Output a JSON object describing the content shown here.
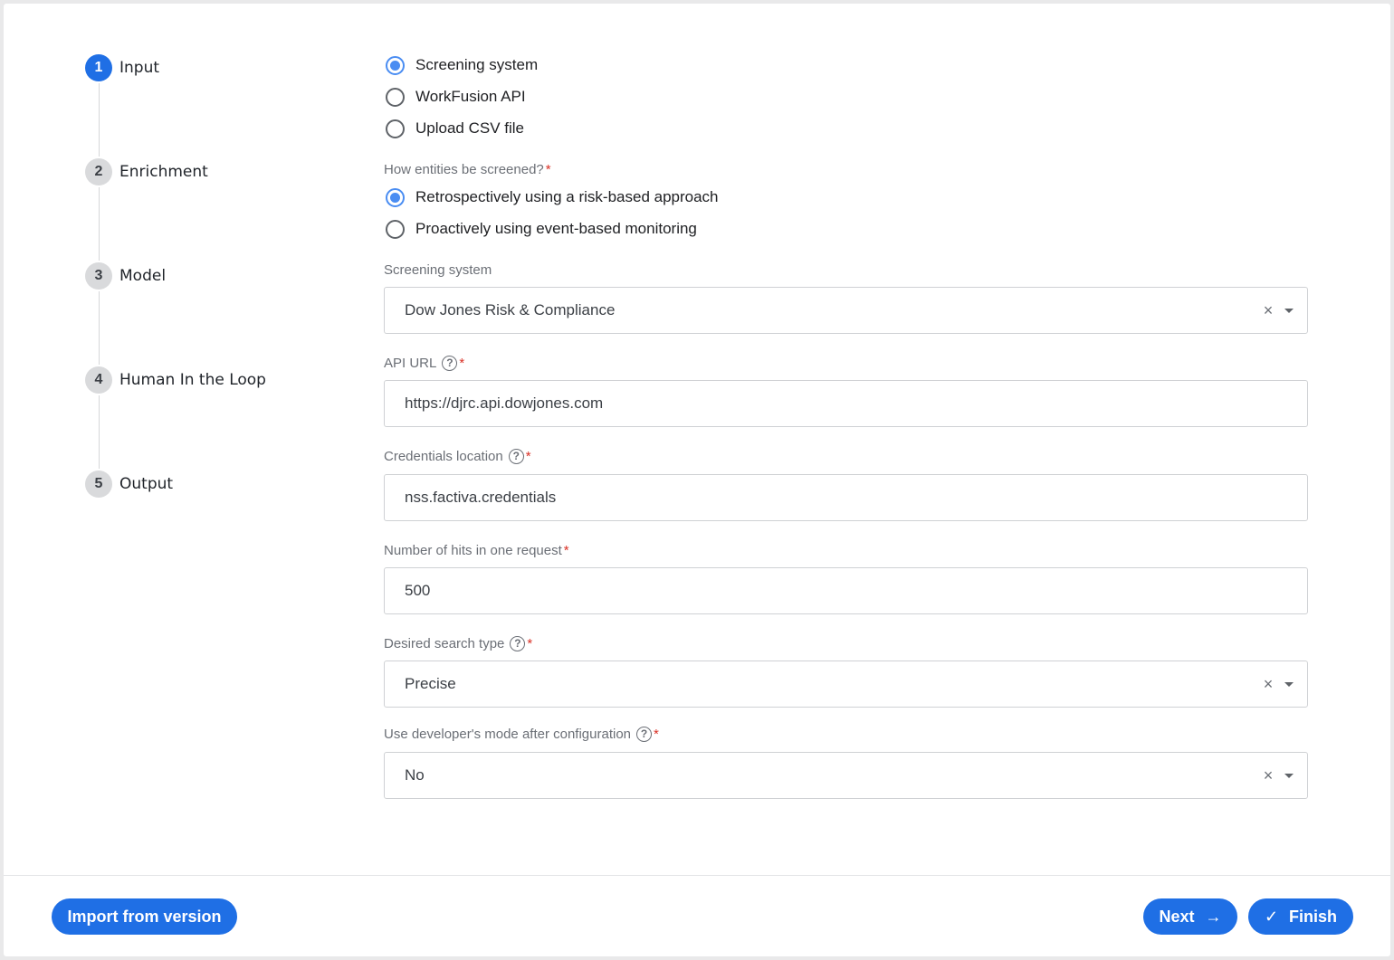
{
  "steps": [
    {
      "number": "1",
      "label": "Input",
      "active": true
    },
    {
      "number": "2",
      "label": "Enrichment",
      "active": false
    },
    {
      "number": "3",
      "label": "Model",
      "active": false
    },
    {
      "number": "4",
      "label": "Human In the Loop",
      "active": false
    },
    {
      "number": "5",
      "label": "Output",
      "active": false
    }
  ],
  "input_source": {
    "options": [
      "Screening system",
      "WorkFusion API",
      "Upload CSV file"
    ],
    "selected": "Screening system"
  },
  "screening_mode": {
    "label": "How entities be screened?",
    "required": "*",
    "options": [
      "Retrospectively using a risk-based approach",
      "Proactively using event-based monitoring"
    ],
    "selected": "Retrospectively using a risk-based approach"
  },
  "fields": {
    "screening_system": {
      "label": "Screening system",
      "value": "Dow Jones Risk & Compliance"
    },
    "api_url": {
      "label": "API URL",
      "required": "*",
      "value": "https://djrc.api.dowjones.com"
    },
    "credentials_location": {
      "label": "Credentials location",
      "required": "*",
      "value": "nss.factiva.credentials"
    },
    "hits_per_request": {
      "label": "Number of hits in one request",
      "required": "*",
      "value": "500"
    },
    "search_type": {
      "label": "Desired search type",
      "required": "*",
      "value": "Precise"
    },
    "developer_mode": {
      "label": "Use developer's mode after configuration",
      "required": "*",
      "value": "No"
    }
  },
  "icons": {
    "help": "?",
    "clear": "×",
    "next_arrow": "→",
    "check": "✓"
  },
  "buttons": {
    "import": "Import from version",
    "next": "Next",
    "finish": "Finish"
  },
  "colors": {
    "primary": "#1f6fe5",
    "radio_checked": "#4a8df2",
    "required": "#d93025"
  }
}
